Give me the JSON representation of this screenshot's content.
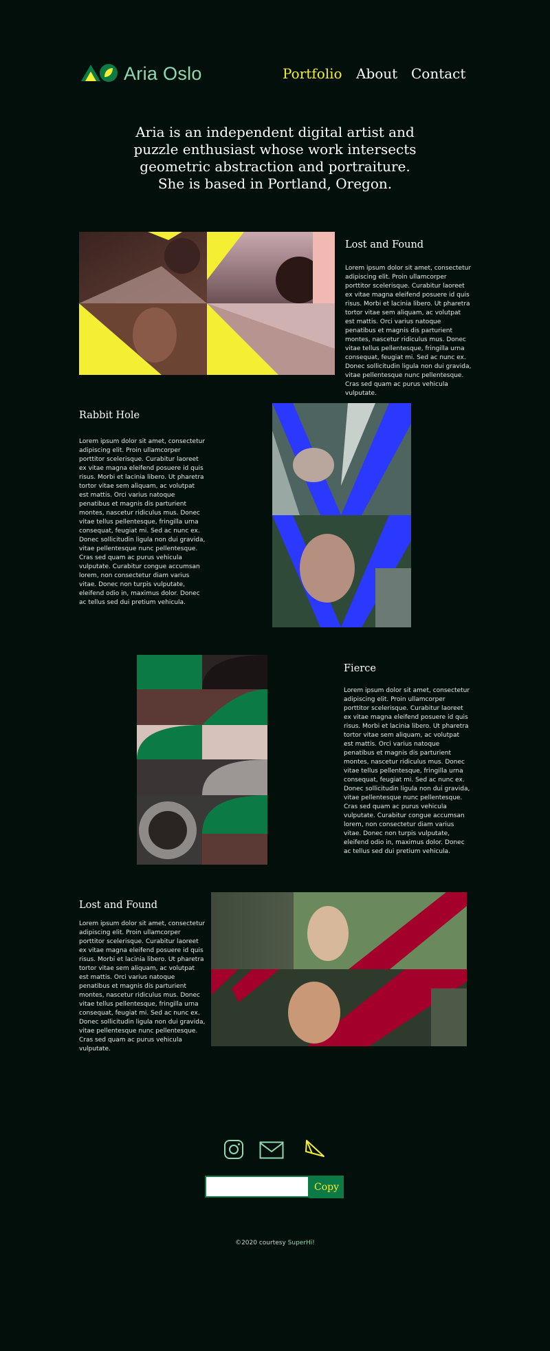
{
  "brand": {
    "name": "Aria Oslo",
    "logo_icon": "triangle-circle-logo"
  },
  "nav": {
    "items": [
      "Portfolio",
      "About",
      "Contact"
    ],
    "active": "Portfolio"
  },
  "intro": {
    "line1": "Aria is an independent digital artist and",
    "line2": "puzzle enthusiast whose work intersects",
    "line3": "geometric abstraction and portraiture.",
    "line4": "She is based in Portland, Oregon."
  },
  "projects": [
    {
      "title": "Lost and Found",
      "description": "Lorem ipsum dolor sit amet, consectetur adipiscing elit. Proin ullamcorper porttitor scelerisque. Curabitur laoreet ex vitae magna eleifend posuere id quis risus. Morbi et lacinia libero. Ut pharetra tortor vitae sem aliquam, ac volutpat est mattis. Orci varius natoque penatibus et magnis dis parturient montes, nascetur ridiculus mus. Donec vitae tellus pellentesque, fringilla urna consequat, feugiat mi. Sed ac nunc ex. Donec sollicitudin ligula non dui gravida, vitae pellentesque nunc pellentesque. Cras sed quam ac purus vehicula vulputate."
    },
    {
      "title": "Rabbit Hole",
      "description": "Lorem ipsum dolor sit amet, consectetur adipiscing elit. Proin ullamcorper porttitor scelerisque. Curabitur laoreet ex vitae magna eleifend posuere id quis risus. Morbi et lacinia libero. Ut pharetra tortor vitae sem aliquam, ac volutpat est mattis. Orci varius natoque penatibus et magnis dis parturient montes, nascetur ridiculus mus. Donec vitae tellus pellentesque, fringilla urna consequat, feugiat mi. Sed ac nunc ex. Donec sollicitudin ligula non dui gravida, vitae pellentesque nunc pellentesque. Cras sed quam ac purus vehicula vulputate. Curabitur congue accumsan lorem, non consectetur diam varius vitae. Donec non turpis vulputate, eleifend odio in, maximus dolor. Donec ac tellus sed dui pretium vehicula."
    },
    {
      "title": "Fierce",
      "description": "Lorem ipsum dolor sit amet, consectetur adipiscing elit. Proin ullamcorper porttitor scelerisque. Curabitur laoreet ex vitae magna eleifend posuere id quis risus. Morbi et lacinia libero. Ut pharetra tortor vitae sem aliquam, ac volutpat est mattis. Orci varius natoque penatibus et magnis dis parturient montes, nascetur ridiculus mus. Donec vitae tellus pellentesque, fringilla urna consequat, feugiat mi. Sed ac nunc ex. Donec sollicitudin ligula non dui gravida, vitae pellentesque nunc pellentesque. Cras sed quam ac purus vehicula vulputate. Curabitur congue accumsan lorem, non consectetur diam varius vitae. Donec non turpis vulputate, eleifend odio in, maximus dolor. Donec ac tellus sed dui pretium vehicula."
    },
    {
      "title": "Lost and Found",
      "description": "Lorem ipsum dolor sit amet, consectetur adipiscing elit. Proin ullamcorper porttitor scelerisque. Curabitur laoreet ex vitae magna eleifend posuere id quis risus. Morbi et lacinia libero. Ut pharetra tortor vitae sem aliquam, ac volutpat est mattis. Orci varius natoque penatibus et magnis dis parturient montes, nascetur ridiculus mus. Donec vitae tellus pellentesque, fringilla urna consequat, feugiat mi. Sed ac nunc ex. Donec sollicitudin ligula non dui gravida, vitae pellentesque nunc pellentesque. Cras sed quam ac purus vehicula vulputate."
    }
  ],
  "social": {
    "icons": [
      "instagram-icon",
      "mail-icon",
      "send-icon"
    ]
  },
  "copy": {
    "input_value": "",
    "button_label": "Copy"
  },
  "footer": {
    "text": "©2020 courtesy ",
    "link": "SuperHi!"
  },
  "colors": {
    "background": "#020f0b",
    "accent_yellow": "#f5ef33",
    "accent_mint": "#8fd9b6",
    "accent_green": "#0b7a45",
    "art_blue": "#2b39ff",
    "art_red": "#a4002c"
  }
}
